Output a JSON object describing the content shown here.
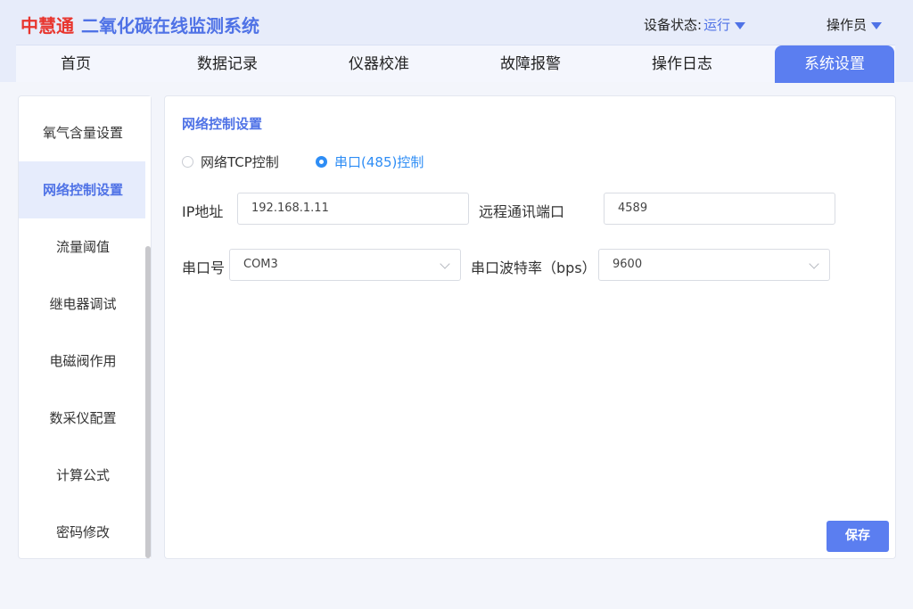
{
  "header": {
    "logo_text": "中慧通",
    "system_title": "二氧化碳在线监测系统",
    "device_status_label": "设备状态:",
    "device_status_value": "运行",
    "operator_label": "操作员"
  },
  "nav": {
    "tabs": [
      {
        "label": "首页",
        "active": false
      },
      {
        "label": "数据记录",
        "active": false
      },
      {
        "label": "仪器校准",
        "active": false
      },
      {
        "label": "故障报警",
        "active": false
      },
      {
        "label": "操作日志",
        "active": false
      },
      {
        "label": "系统设置",
        "active": true
      }
    ]
  },
  "sidebar": {
    "items": [
      {
        "label": "氧气含量设置",
        "active": false
      },
      {
        "label": "网络控制设置",
        "active": true
      },
      {
        "label": "流量阈值",
        "active": false
      },
      {
        "label": "继电器调试",
        "active": false
      },
      {
        "label": "电磁阀作用",
        "active": false
      },
      {
        "label": "数采仪配置",
        "active": false
      },
      {
        "label": "计算公式",
        "active": false
      },
      {
        "label": "密码修改",
        "active": false
      }
    ]
  },
  "main": {
    "title": "网络控制设置",
    "radio_tcp": {
      "label": "网络TCP控制",
      "checked": false
    },
    "radio_serial": {
      "label": "串口(485)控制",
      "checked": true
    },
    "ip_label": "IP地址",
    "ip_value": "192.168.1.11",
    "port_label": "远程通讯端口",
    "port_value": "4589",
    "serial_label": "串口号",
    "serial_value": "COM3",
    "baud_label": "串口波特率（bps）",
    "baud_value": "9600",
    "save_label": "保存"
  },
  "colors": {
    "accent": "#5b7ef0",
    "brand_red": "#e8352e",
    "radio_blue": "#2e8df5"
  }
}
